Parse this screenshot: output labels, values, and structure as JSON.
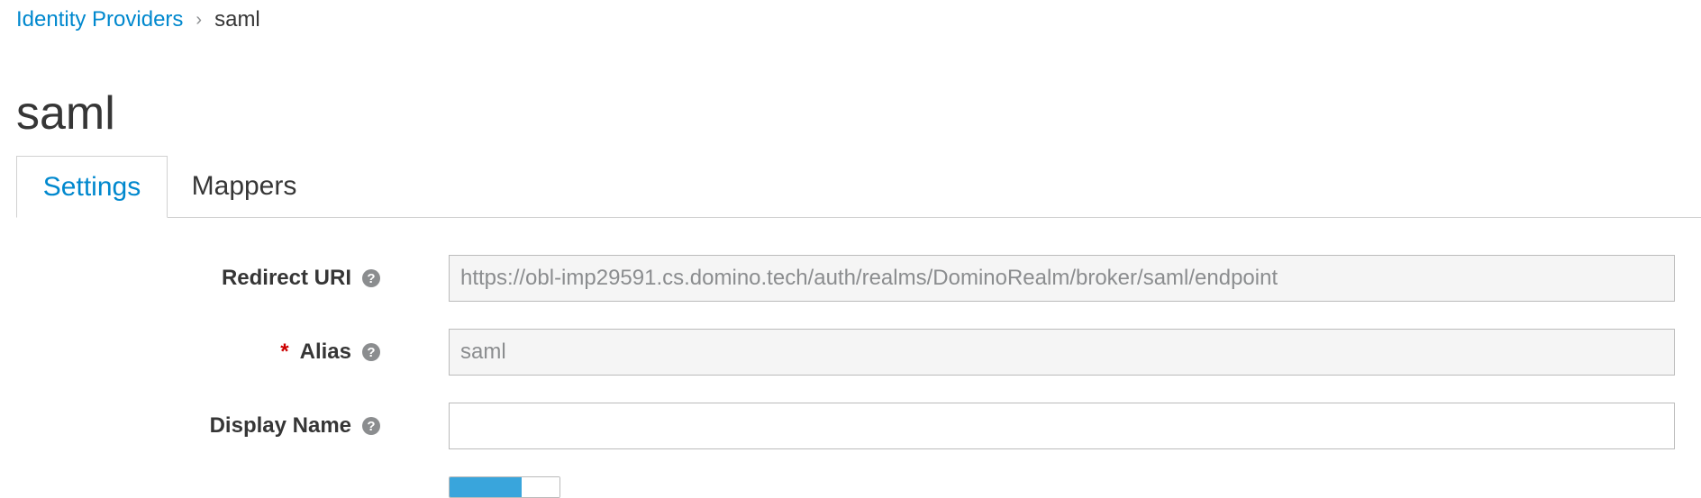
{
  "breadcrumb": {
    "parent": "Identity Providers",
    "separator": "›",
    "current": "saml"
  },
  "page": {
    "title": "saml"
  },
  "tabs": [
    {
      "label": "Settings",
      "active": true
    },
    {
      "label": "Mappers",
      "active": false
    }
  ],
  "form": {
    "redirect_uri": {
      "label": "Redirect URI",
      "value": "https://obl-imp29591.cs.domino.tech/auth/realms/DominoRealm/broker/saml/endpoint"
    },
    "alias": {
      "required_mark": "*",
      "label": "Alias",
      "value": "saml"
    },
    "display_name": {
      "label": "Display Name",
      "value": ""
    },
    "help_glyph": "?"
  },
  "colors": {
    "link": "#0088ce",
    "required": "#cc0000",
    "toggle_on": "#39a5dc"
  },
  "icons": {
    "help": "question-circle-icon",
    "separator": "chevron-right-icon"
  }
}
